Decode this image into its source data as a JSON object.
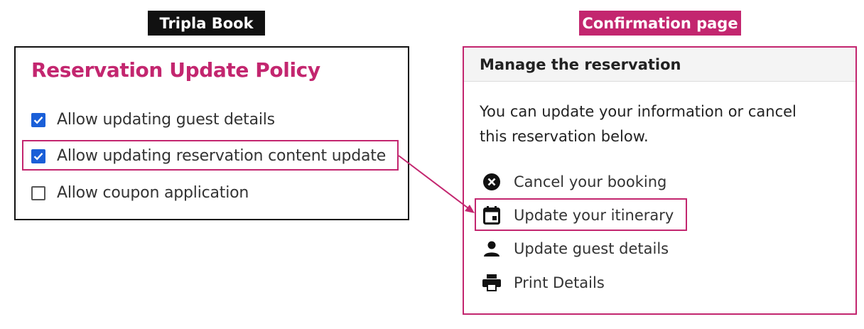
{
  "labels": {
    "left": "Tripla Book",
    "right": "Confirmation page"
  },
  "policy": {
    "title": "Reservation Update Policy",
    "options": [
      {
        "label": "Allow updating guest details",
        "checked": true
      },
      {
        "label": "Allow updating reservation content update",
        "checked": true
      },
      {
        "label": "Allow coupon application",
        "checked": false
      }
    ]
  },
  "manage": {
    "header": "Manage the reservation",
    "description": "You can update your information or cancel this reservation below.",
    "actions": [
      {
        "label": "Cancel your booking",
        "icon": "cancel-circle-icon"
      },
      {
        "label": "Update your itinerary",
        "icon": "calendar-icon"
      },
      {
        "label": "Update guest details",
        "icon": "person-icon"
      },
      {
        "label": "Print Details",
        "icon": "printer-icon"
      }
    ]
  },
  "colors": {
    "accent": "#c3266f",
    "checkbox": "#1a5fd8",
    "dark_label": "#111111"
  }
}
